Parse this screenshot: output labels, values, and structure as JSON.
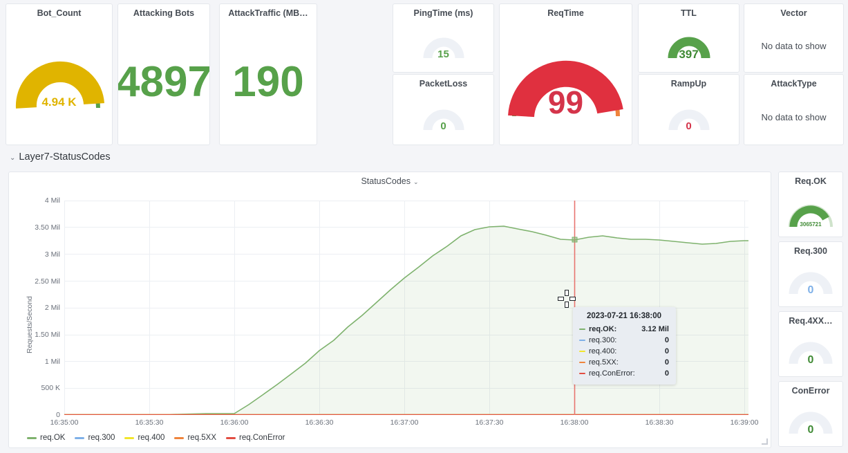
{
  "top_panels": [
    {
      "title": "Bot_Count",
      "kind": "gauge",
      "value": "4.94 K",
      "value_color": "#e0b400",
      "fill_color": "#e0b400",
      "fraction": 0.94,
      "track": "green"
    },
    {
      "title": "Attacking Bots",
      "kind": "stat",
      "value": "4897",
      "value_color": "#57a14a"
    },
    {
      "title": "AttackTraffic (MB…",
      "kind": "stat",
      "value": "190",
      "value_color": "#57a14a"
    },
    {
      "title": "PingTime (ms)",
      "kind": "gauge",
      "value": "15",
      "value_color": "#57a14a",
      "fill_color": "#eef1f6",
      "fraction": 0.0,
      "track": "plain"
    },
    {
      "title": "PacketLoss",
      "kind": "gauge",
      "value": "0",
      "value_color": "#57a14a",
      "fill_color": "#eef1f6",
      "fraction": 0.0,
      "track": "plain"
    },
    {
      "title": "ReqTime",
      "kind": "gauge",
      "value": "99",
      "value_color": "#d4344a",
      "fill_color": "#e0303f",
      "fraction": 0.99,
      "track": "threshold"
    },
    {
      "title": "TTL",
      "kind": "gauge",
      "value": "397",
      "value_color": "#57a14a",
      "fill_color": "#57a14a",
      "fraction": 0.8,
      "track": "none"
    },
    {
      "title": "RampUp",
      "kind": "gauge",
      "value": "0",
      "value_color": "#d4344a",
      "fill_color": "#eef1f6",
      "fraction": 0.0,
      "track": "plain"
    },
    {
      "title": "Vector",
      "kind": "nodata",
      "value": "No data to show"
    },
    {
      "title": "AttackType",
      "kind": "nodata",
      "value": "No data to show"
    }
  ],
  "row": {
    "title": "Layer7-StatusCodes",
    "chevron": "⌄"
  },
  "timeseries_panel": {
    "title": "StatusCodes",
    "dropdown_caret": "⌄"
  },
  "side_panels": [
    {
      "title": "Req.OK",
      "value": "3065721",
      "value_color": "#57a14a",
      "fill_color": "#57a14a",
      "fraction": 0.77,
      "track": "green"
    },
    {
      "title": "Req.300",
      "value": "0",
      "value_color": "#7eb0e8",
      "fill_color": "#eef1f6",
      "fraction": 0.0,
      "track": "plain"
    },
    {
      "title": "Req.4XX…",
      "value": "0",
      "value_color": "#57a14a",
      "fill_color": "#eef1f6",
      "fraction": 0.0,
      "track": "plain"
    },
    {
      "title": "ConError",
      "value": "0",
      "value_color": "#57a14a",
      "fill_color": "#eef1f6",
      "fraction": 0.0,
      "track": "plain"
    }
  ],
  "tooltip": {
    "time": "2023-07-21 16:38:00",
    "rows": [
      {
        "name": "req.OK:",
        "value": "3.12 Mil",
        "color": "#7eb26d",
        "bold": true
      },
      {
        "name": "req.300:",
        "value": "0",
        "color": "#7eb0e8",
        "bold": false
      },
      {
        "name": "req.400:",
        "value": "0",
        "color": "#f2e52b",
        "bold": false
      },
      {
        "name": "req.5XX:",
        "value": "0",
        "color": "#ef843c",
        "bold": false
      },
      {
        "name": "req.ConError:",
        "value": "0",
        "color": "#e24d42",
        "bold": false
      }
    ]
  },
  "legend": [
    {
      "label": "req.OK",
      "color": "#7eb26d"
    },
    {
      "label": "req.300",
      "color": "#7eb0e8"
    },
    {
      "label": "req.400",
      "color": "#f2e52b"
    },
    {
      "label": "req.5XX",
      "color": "#ef843c"
    },
    {
      "label": "req.ConError",
      "color": "#e24d42"
    }
  ],
  "chart_data": {
    "type": "area",
    "title": "StatusCodes",
    "xlabel": "",
    "ylabel": "Requests/Second",
    "ylim": [
      0,
      4000000
    ],
    "yticks": [
      "0",
      "500 K",
      "1 Mil",
      "1.50 Mil",
      "2 Mil",
      "2.50 Mil",
      "3 Mil",
      "3.50 Mil",
      "4 Mil"
    ],
    "ytick_values": [
      0,
      500000,
      1000000,
      1500000,
      2000000,
      2500000,
      3000000,
      3500000,
      4000000
    ],
    "xticks": [
      "16:35:00",
      "16:35:30",
      "16:36:00",
      "16:36:30",
      "16:37:00",
      "16:37:30",
      "16:38:00",
      "16:38:30",
      "16:39:00"
    ],
    "xlim": [
      "16:35:00",
      "16:39:10"
    ],
    "grid": true,
    "legend_position": "bottom-left",
    "cursor_time": "16:38:00",
    "series": [
      {
        "name": "req.OK",
        "color": "#7eb26d",
        "fill": true,
        "x": [
          "16:35:00",
          "16:35:10",
          "16:35:20",
          "16:35:30",
          "16:35:40",
          "16:35:50",
          "16:36:00",
          "16:36:05",
          "16:36:10",
          "16:36:15",
          "16:36:20",
          "16:36:25",
          "16:36:30",
          "16:36:35",
          "16:36:40",
          "16:36:45",
          "16:36:50",
          "16:36:55",
          "16:37:00",
          "16:37:05",
          "16:37:10",
          "16:37:15",
          "16:37:20",
          "16:37:25",
          "16:37:30",
          "16:37:40",
          "16:37:50",
          "16:38:00",
          "16:38:10",
          "16:38:20",
          "16:38:30",
          "16:38:40",
          "16:38:50",
          "16:39:00",
          "16:39:10"
        ],
        "y": [
          0,
          0,
          0,
          0,
          0,
          0,
          20000,
          180000,
          380000,
          560000,
          760000,
          980000,
          1180000,
          1320000,
          1560000,
          1760000,
          2000000,
          2240000,
          2480000,
          2680000,
          2900000,
          3080000,
          3280000,
          3380000,
          3400000,
          3390000,
          3300000,
          3120000,
          3160000,
          3180000,
          3140000,
          3140000,
          3120000,
          3080000,
          3120000
        ]
      },
      {
        "name": "req.300",
        "color": "#7eb0e8",
        "fill": false,
        "constant": 0
      },
      {
        "name": "req.400",
        "color": "#f2e52b",
        "fill": false,
        "constant": 0
      },
      {
        "name": "req.5XX",
        "color": "#ef843c",
        "fill": false,
        "constant": 0
      },
      {
        "name": "req.ConError",
        "color": "#e24d42",
        "fill": false,
        "constant": 0
      }
    ]
  }
}
